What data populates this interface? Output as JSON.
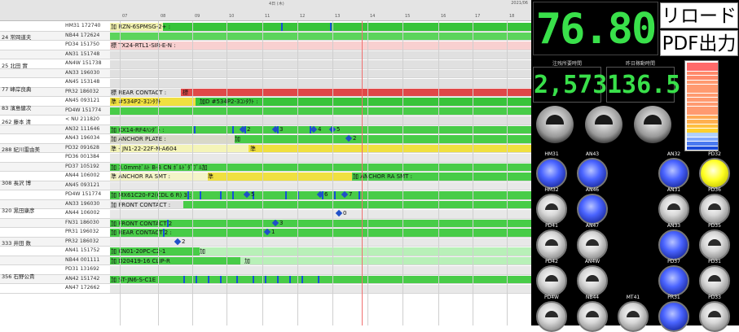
{
  "header": {
    "date": "4日 (木)",
    "year": "2021/06",
    "hours": [
      "07",
      "08",
      "09",
      "10",
      "11",
      "12",
      "13",
      "14",
      "15",
      "16",
      "17",
      "18"
    ]
  },
  "gantt": {
    "operators": [
      "24 常岡道夫",
      "25 北田 實",
      "77 峰岸良典",
      "83 濱島健次",
      "262 藤本 清",
      "288 紀川雷由美",
      "308 長沢 博",
      "320 黒田康彦",
      "333 井田 数",
      "356 石野公貴"
    ],
    "rows": [
      {
        "m": "HM31 172740",
        "t": "加 RZN-6SPMSG-2+ :"
      },
      {
        "m": "NB44 172624",
        "t": ""
      },
      {
        "m": "PD34 151750",
        "t": "標 TX24-RTL1-SIR-E-N :"
      },
      {
        "m": "AN31 151748",
        "t": ""
      },
      {
        "m": "AN4W 151738",
        "t": ""
      },
      {
        "m": "AN33 196030",
        "t": ""
      },
      {
        "m": "AN45 153148",
        "t": ""
      },
      {
        "m": "PR32 186032",
        "t": "標 REAR CONTACT :",
        "t2": "標"
      },
      {
        "m": "AN45 093121",
        "t": "準 #534P2-3ｺﾝﾀｸﾄ",
        "t2": "加D #534P2-3ｺﾝﾀｸﾄ :"
      },
      {
        "m": "PD4W 151774",
        "t": ""
      },
      {
        "m": "< NU 211820",
        "t": ""
      },
      {
        "m": "AN32 111646",
        "t": "加 KX14-RF4ﾊﾝﾀﾞﾄ :",
        "d": [
          "2",
          "3",
          "4",
          "5"
        ]
      },
      {
        "m": "AN43 196034",
        "t": "加 ANCHOR PLATE :",
        "t2": "加",
        "d": [
          "2"
        ]
      },
      {
        "m": "PD32 091628",
        "t": "準 - JN1-22-22F-N-A604",
        "t2": "準"
      },
      {
        "m": "PD36 001384",
        "t": ""
      },
      {
        "m": "PD37 105192",
        "t": "加 3.0mmﾎﾞﾙﾄ B-B CN ﾎﾞﾙﾄﾞﾀﾞﾌﾞﾙ加"
      },
      {
        "m": "AN44 106002",
        "t": "準 ANCHOR RA SMT :",
        "t2": "準",
        "t3": "加 ANCHOR RA SMT :"
      },
      {
        "m": "AN45 093121",
        "t": ""
      },
      {
        "m": "PD4W 151774",
        "t": "加 MX61C20-F2(CDL 6 R) 3 :",
        "d": [
          "5",
          "6",
          "7"
        ]
      },
      {
        "m": "AN33 196030",
        "t": "加 FRONT CONTACT :"
      },
      {
        "m": "AN44 106002",
        "t": "",
        "d": [
          "0"
        ]
      },
      {
        "m": "FN31 186030",
        "t": "加 FRONT CONTACT 2",
        "d": [
          "3"
        ]
      },
      {
        "m": "PR31 196032",
        "t": "加 REAR CONTACT 2 :",
        "d": [
          "1"
        ]
      },
      {
        "m": "PR32 186032",
        "t": "",
        "d": [
          "2"
        ]
      },
      {
        "m": "AN41 151752",
        "t": "加 KN01-20PC-C2-1",
        "t2": "加"
      },
      {
        "m": "NB44 001111",
        "t": "加 D20419-16 CLIP-R",
        "t2": "加"
      },
      {
        "m": "PD31 131692",
        "t": ""
      },
      {
        "m": "AN42 151742",
        "t": "加 ST-JN6-S-C1E"
      },
      {
        "m": "AN47 172662",
        "t": ""
      }
    ]
  },
  "panel": {
    "big_value": "76.80",
    "reload": "リロード",
    "pdf": "PDF出力",
    "lbl1": "注残所要時間",
    "lbl2": "昨日稼動時間",
    "val1": "2,573",
    "val2": "136.5",
    "meter_colors": [
      "#ff6a6a",
      "#ff6a6a",
      "#ff8a6a",
      "#ff8a6a",
      "#ff9a70",
      "#ff9a70",
      "#ff9a70",
      "#ff9a70",
      "#ff9a70",
      "#ff9a70",
      "#ff9a70",
      "#ff9a70",
      "#ffaa55",
      "#ffb050",
      "#ffc040",
      "#ffd030",
      "#b0d0ff",
      "#80a8ff",
      "#4a7af0",
      "#1a4ad8"
    ],
    "lamps": [
      {
        "l": "HM31",
        "c": "blue"
      },
      {
        "l": "AN43",
        "c": "blue"
      },
      {
        "l": "",
        "c": "none"
      },
      {
        "l": "AN32",
        "c": "blue"
      },
      {
        "l": "PD32",
        "c": "yellow"
      },
      {
        "l": "HM32",
        "c": "grey"
      },
      {
        "l": "AN46",
        "c": "blue"
      },
      {
        "l": "",
        "c": "none"
      },
      {
        "l": "AN31",
        "c": "grey"
      },
      {
        "l": "PD36",
        "c": "grey"
      },
      {
        "l": "PD41",
        "c": "grey"
      },
      {
        "l": "AN47",
        "c": "grey"
      },
      {
        "l": "",
        "c": "none"
      },
      {
        "l": "AN33",
        "c": "blue"
      },
      {
        "l": "PD35",
        "c": "grey"
      },
      {
        "l": "PD42",
        "c": "grey"
      },
      {
        "l": "AN4W",
        "c": "grey"
      },
      {
        "l": "",
        "c": "none"
      },
      {
        "l": "PD37",
        "c": "blue"
      },
      {
        "l": "PD31",
        "c": "grey"
      },
      {
        "l": "PD4W",
        "c": "grey"
      },
      {
        "l": "NB44",
        "c": "grey"
      },
      {
        "l": "MT41",
        "c": "grey"
      },
      {
        "l": "PR31",
        "c": "blue"
      },
      {
        "l": "PD33",
        "c": "grey"
      }
    ]
  }
}
